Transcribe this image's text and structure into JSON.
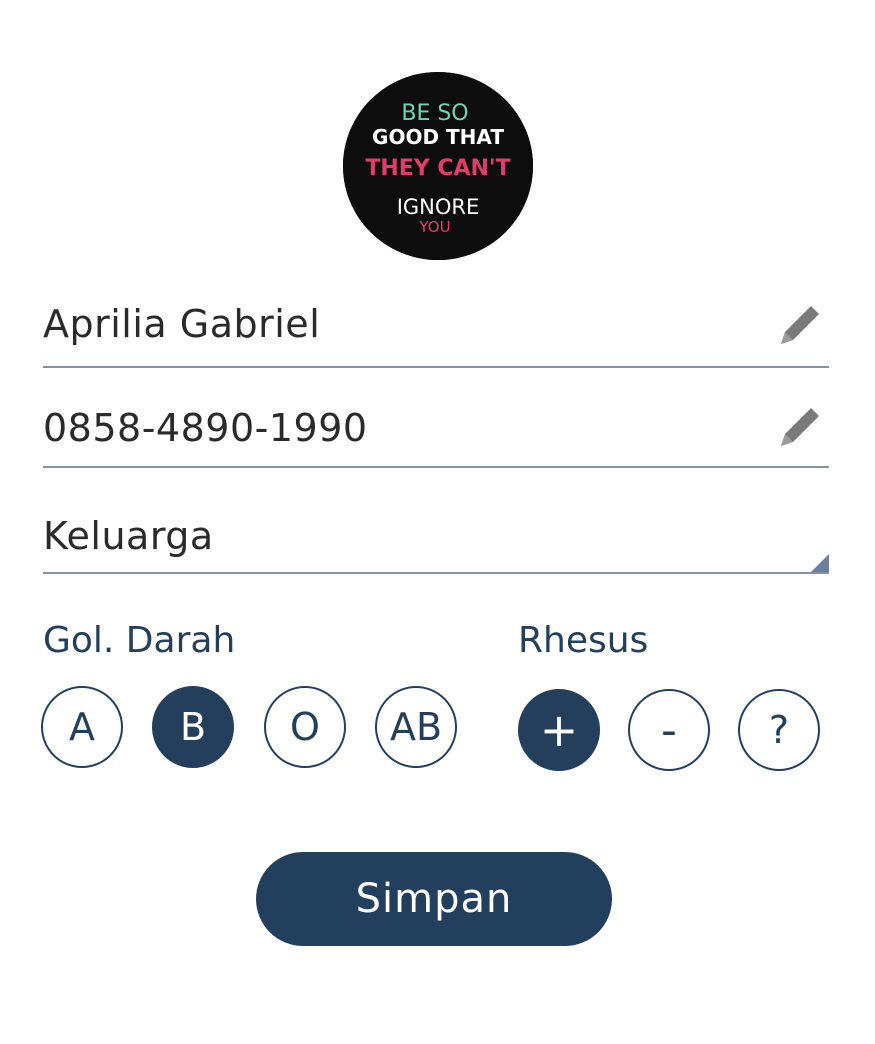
{
  "profile": {
    "avatar_alt": "avatar",
    "avatar_text": [
      "BE SO",
      "GOOD THAT",
      "THEY CAN'T",
      "IGNORE",
      "YOU"
    ]
  },
  "form": {
    "name_value": "Aprilia Gabriel",
    "phone_value": "0858-4890-1990",
    "relation_value": "Keluarga"
  },
  "blood": {
    "label": "Gol. Darah",
    "options": [
      "A",
      "B",
      "O",
      "AB"
    ],
    "selected": "B"
  },
  "rhesus": {
    "label": "Rhesus",
    "options": [
      "+",
      "-",
      "?"
    ],
    "selected": "+"
  },
  "actions": {
    "save_label": "Simpan"
  },
  "colors": {
    "primary": "#233f5e",
    "underline": "#8492a6",
    "icon": "#7a7a7a"
  }
}
